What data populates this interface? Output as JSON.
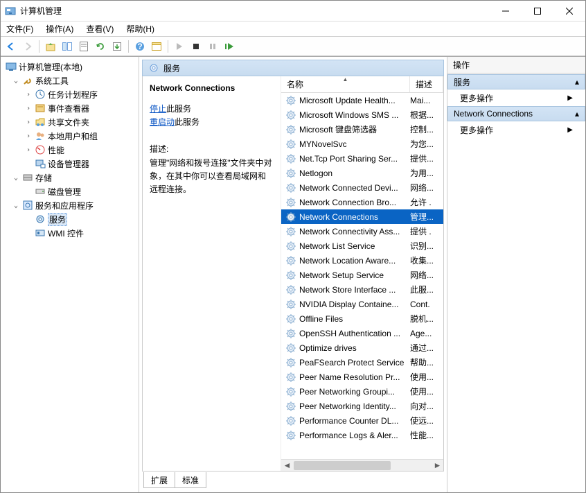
{
  "window": {
    "title": "计算机管理"
  },
  "menu": {
    "file": "文件(F)",
    "action": "操作(A)",
    "view": "查看(V)",
    "help": "帮助(H)"
  },
  "tree": {
    "root": "计算机管理(本地)",
    "system_tools": "系统工具",
    "task_scheduler": "任务计划程序",
    "event_viewer": "事件查看器",
    "shared_folders": "共享文件夹",
    "local_users": "本地用户和组",
    "performance": "性能",
    "device_manager": "设备管理器",
    "storage": "存储",
    "disk_management": "磁盘管理",
    "services_apps": "服务和应用程序",
    "services": "服务",
    "wmi_control": "WMI 控件"
  },
  "mid": {
    "header": "服务",
    "selected_name": "Network Connections",
    "stop_link": "停止",
    "stop_suffix": "此服务",
    "restart_link": "重启动",
    "restart_suffix": "此服务",
    "desc_label": "描述:",
    "desc_text": "管理\"网络和拨号连接\"文件夹中对象，在其中你可以查看局域网和远程连接。",
    "col_name": "名称",
    "col_desc": "描述",
    "tab_extended": "扩展",
    "tab_standard": "标准"
  },
  "services": [
    {
      "name": "Microsoft Update Health...",
      "desc": "Mai..."
    },
    {
      "name": "Microsoft Windows SMS ...",
      "desc": "根据..."
    },
    {
      "name": "Microsoft 键盘筛选器",
      "desc": "控制..."
    },
    {
      "name": "MYNovelSvc",
      "desc": "为您..."
    },
    {
      "name": "Net.Tcp Port Sharing Ser...",
      "desc": "提供..."
    },
    {
      "name": "Netlogon",
      "desc": "为用..."
    },
    {
      "name": "Network Connected Devi...",
      "desc": "网络..."
    },
    {
      "name": "Network Connection Bro...",
      "desc": "允许 ."
    },
    {
      "name": "Network Connections",
      "desc": "管理...",
      "selected": true
    },
    {
      "name": "Network Connectivity Ass...",
      "desc": "提供 ."
    },
    {
      "name": "Network List Service",
      "desc": "识别..."
    },
    {
      "name": "Network Location Aware...",
      "desc": "收集..."
    },
    {
      "name": "Network Setup Service",
      "desc": "网络..."
    },
    {
      "name": "Network Store Interface ...",
      "desc": "此服..."
    },
    {
      "name": "NVIDIA Display Containe...",
      "desc": "Cont."
    },
    {
      "name": "Offline Files",
      "desc": "脱机..."
    },
    {
      "name": "OpenSSH Authentication ...",
      "desc": "Age..."
    },
    {
      "name": "Optimize drives",
      "desc": "通过..."
    },
    {
      "name": "PeaFSearch Protect Service",
      "desc": "帮助..."
    },
    {
      "name": "Peer Name Resolution Pr...",
      "desc": "使用..."
    },
    {
      "name": "Peer Networking Groupi...",
      "desc": "使用..."
    },
    {
      "name": "Peer Networking Identity...",
      "desc": "向对..."
    },
    {
      "name": "Performance Counter DL...",
      "desc": "使远..."
    },
    {
      "name": "Performance Logs & Aler...",
      "desc": "性能..."
    }
  ],
  "actions": {
    "head": "操作",
    "section1": "服务",
    "more1": "更多操作",
    "section2": "Network Connections",
    "more2": "更多操作"
  }
}
